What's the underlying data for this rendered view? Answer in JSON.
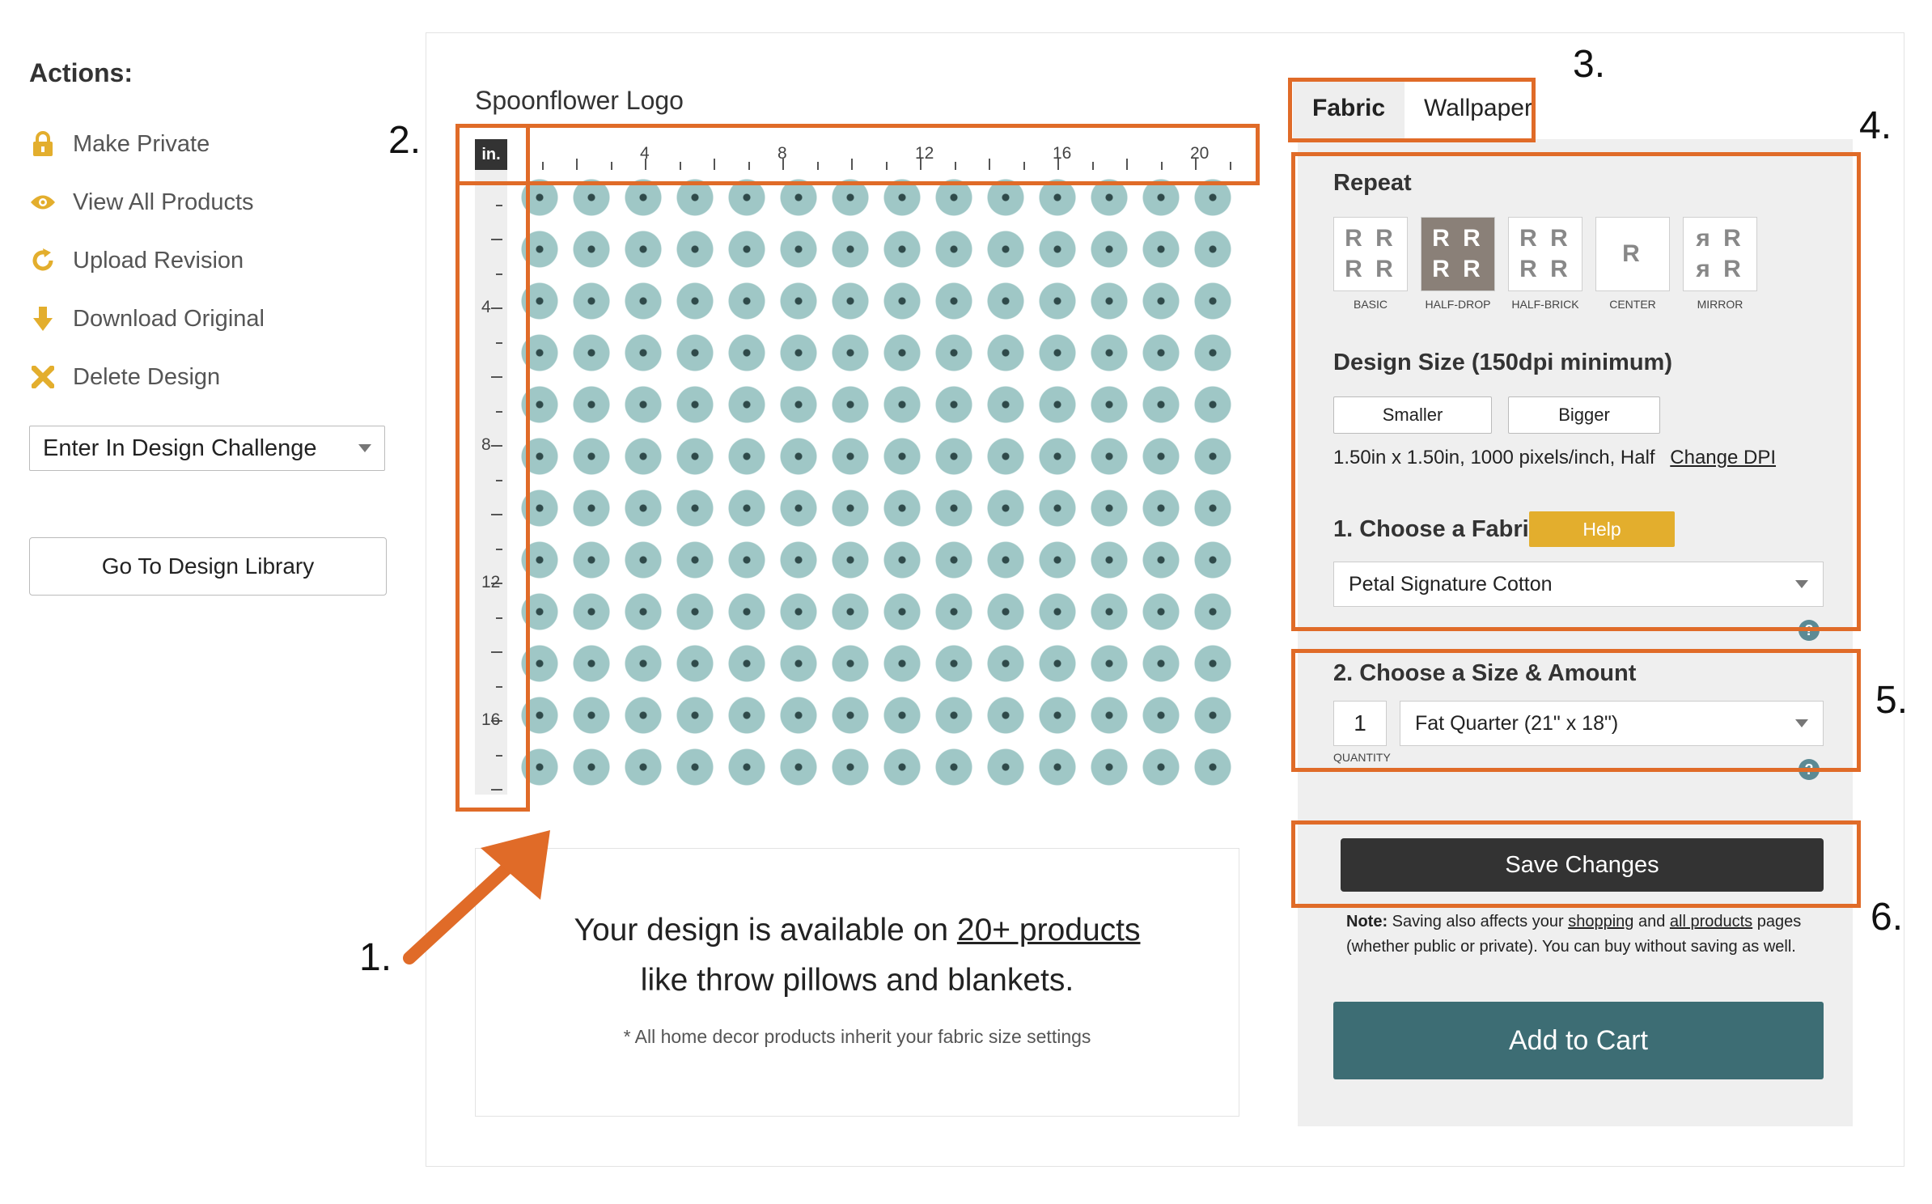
{
  "sidebar": {
    "title": "Actions:",
    "items": [
      {
        "label": "Make Private",
        "icon": "lock-icon",
        "color": "#e3ae2d"
      },
      {
        "label": "View All Products",
        "icon": "eye-icon",
        "color": "#e3ae2d"
      },
      {
        "label": "Upload Revision",
        "icon": "refresh-icon",
        "color": "#e3ae2d"
      },
      {
        "label": "Download Original",
        "icon": "download-arrow-icon",
        "color": "#e3ae2d"
      },
      {
        "label": "Delete Design",
        "icon": "x-icon",
        "color": "#e3ae2d"
      }
    ],
    "challenge_select": "Enter In Design Challenge",
    "library_button": "Go To Design Library"
  },
  "design": {
    "title": "Spoonflower Logo",
    "unit": "in.",
    "ruler_h_labels": [
      "4",
      "8",
      "12",
      "16",
      "20"
    ],
    "ruler_v_labels": [
      "4",
      "8",
      "12",
      "16"
    ]
  },
  "promo": {
    "line1_prefix": "Your design is available on ",
    "line1_link": "20+ products",
    "line2": "like throw pillows and blankets.",
    "note": "* All home decor products inherit your fabric size settings"
  },
  "tabs": [
    "Fabric",
    "Wallpaper"
  ],
  "config": {
    "repeat_label": "Repeat",
    "repeat_options": [
      {
        "caption": "BASIC",
        "glyph": "R R R R",
        "selected": false
      },
      {
        "caption": "HALF-DROP",
        "glyph": "R R R R",
        "selected": true
      },
      {
        "caption": "HALF-BRICK",
        "glyph": "R R R R",
        "selected": false
      },
      {
        "caption": "CENTER",
        "glyph": "R",
        "selected": false
      },
      {
        "caption": "MIRROR",
        "glyph": "ᴙ R ᴙ R",
        "selected": false
      }
    ],
    "design_size_label": "Design Size (150dpi minimum)",
    "smaller_label": "Smaller",
    "bigger_label": "Bigger",
    "size_info": "1.50in x 1.50in, 1000 pixels/inch, Half",
    "change_dpi": "Change DPI",
    "fabric_label": "1. Choose a Fabric",
    "help_label": "Help",
    "fabric_value": "Petal Signature Cotton",
    "size_amount_label": "2. Choose a Size & Amount",
    "quantity": "1",
    "quantity_caption": "QUANTITY",
    "size_value": "Fat Quarter (21\" x 18\")",
    "help_q": "?",
    "save_label": "Save Changes",
    "note_bold": "Note:",
    "note_text_1": " Saving also affects your ",
    "note_link_1": "shopping",
    "note_text_2": " and ",
    "note_link_2": "all products",
    "note_text_3": " pages (whether public or private). You can buy without saving as well.",
    "cart_label": "Add to Cart"
  },
  "annotations": [
    "1.",
    "2.",
    "3.",
    "4.",
    "5.",
    "6."
  ],
  "colors": {
    "highlight": "#e06b28",
    "accent_gold": "#e3ae2d",
    "cart_teal": "#3d6d74",
    "save_dark": "#333333"
  }
}
